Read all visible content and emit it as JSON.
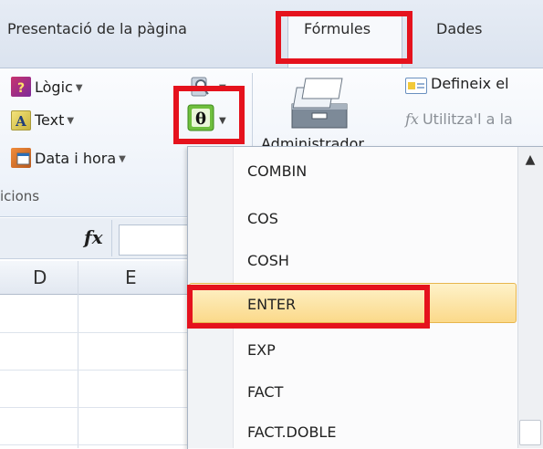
{
  "tabs": [
    {
      "label": "Presentació de la pàgina"
    },
    {
      "label": "Fórmules"
    },
    {
      "label": "Dades"
    }
  ],
  "ribbon": {
    "logic_label": "Lògic",
    "text_label": "Text",
    "datetime_label": "Data i hora",
    "group_label": "icions",
    "admin_label": "Administrador",
    "define_name_label": "Defineix el",
    "use_in_formula_label": "Utilitza'l a la",
    "fx_label": "fx"
  },
  "sheet": {
    "fx_symbol": "fx",
    "columns": [
      "D",
      "E"
    ]
  },
  "dropdown": {
    "items": [
      "COMBIN",
      "COS",
      "COSH",
      "ENTER",
      "EXP",
      "FACT",
      "FACT.DOBLE"
    ],
    "highlighted": "ENTER"
  },
  "colors": {
    "highlight_red": "#e5121d",
    "hover_gold": "#fbd98a"
  }
}
